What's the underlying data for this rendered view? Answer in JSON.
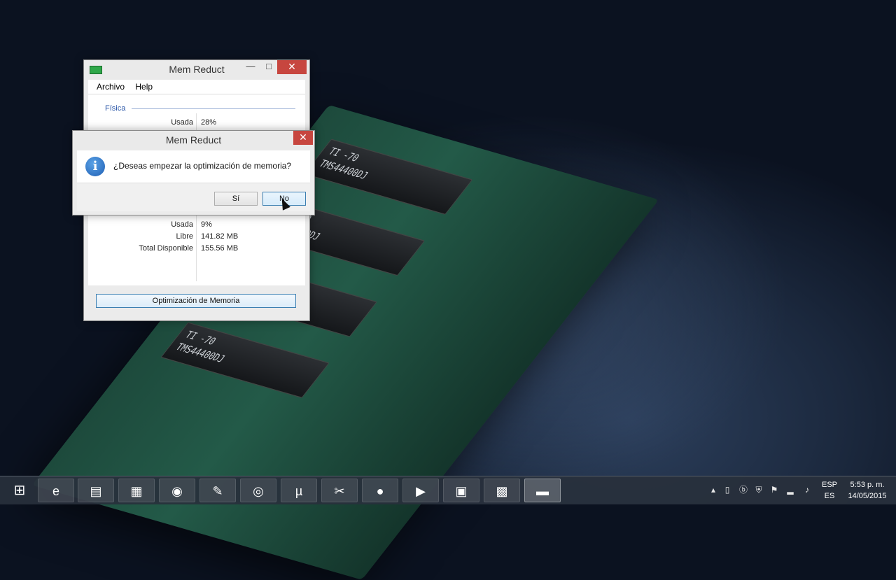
{
  "main_window": {
    "title": "Mem Reduct",
    "menu": [
      "Archivo",
      "Help"
    ],
    "section_physical": "Física",
    "physical_used_label": "Usada",
    "physical_used_value": "28%",
    "lower_used_label": "Usada",
    "lower_used_value": "9%",
    "free_label": "Libre",
    "free_value": "141.82 MB",
    "total_label": "Total Disponible",
    "total_value": "155.56 MB",
    "optimize_button": "Optimización de Memoria"
  },
  "dialog": {
    "title": "Mem Reduct",
    "message": "¿Deseas empezar la optimización de memoria?",
    "yes_button": "Sí",
    "no_button": "No"
  },
  "taskbar": {
    "items": [
      {
        "name": "start-button",
        "glyph": "⊞"
      },
      {
        "name": "internet-explorer-icon",
        "glyph": "e"
      },
      {
        "name": "file-explorer-icon",
        "glyph": "▤"
      },
      {
        "name": "store-icon",
        "glyph": "▦"
      },
      {
        "name": "chrome-icon",
        "glyph": "◉"
      },
      {
        "name": "paint-icon",
        "glyph": "✎"
      },
      {
        "name": "media-disc-icon",
        "glyph": "◎"
      },
      {
        "name": "utorrent-icon",
        "glyph": "µ"
      },
      {
        "name": "mp3-direct-cut-icon",
        "glyph": "✂"
      },
      {
        "name": "record-icon",
        "glyph": "●"
      },
      {
        "name": "media-player-icon",
        "glyph": "▶"
      },
      {
        "name": "network-icon",
        "glyph": "▣"
      },
      {
        "name": "resource-monitor-icon",
        "glyph": "▩"
      },
      {
        "name": "mem-reduct-icon",
        "glyph": "▬"
      }
    ],
    "tray": {
      "language_top": "ESP",
      "language_bottom": "ES",
      "time": "5:53 p. m.",
      "date": "14/05/2015"
    }
  },
  "colors": {
    "accent_blue": "#2b57a8",
    "close_red": "#c7463f",
    "button_focus": "#3c7fb1"
  }
}
